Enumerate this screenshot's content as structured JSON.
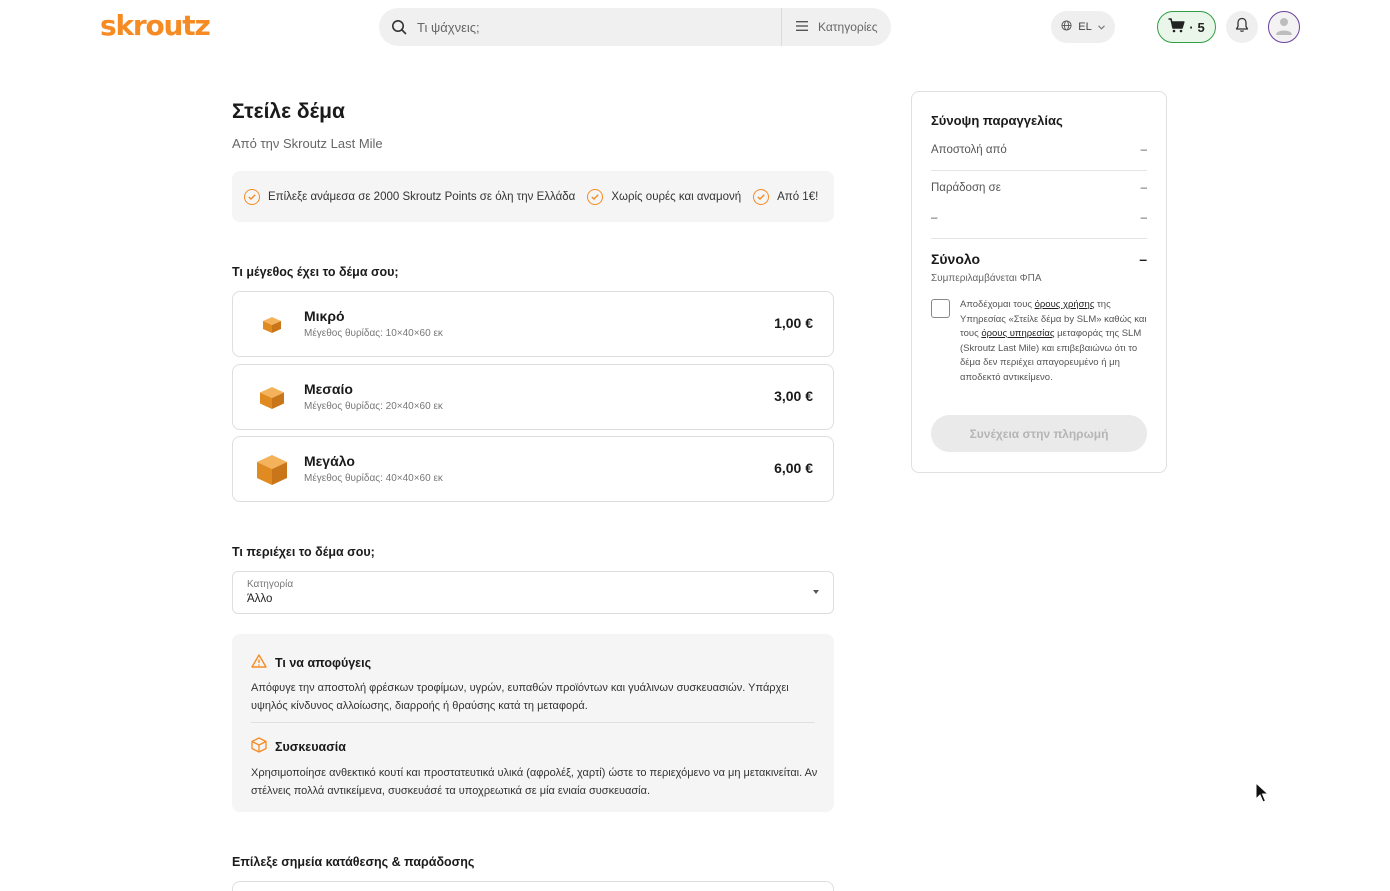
{
  "header": {
    "logo": "skroutz",
    "search_placeholder": "Τι ψάχνεις;",
    "categories_label": "Κατηγορίες",
    "language": "EL",
    "cart_count": "5"
  },
  "page": {
    "title": "Στείλε δέμα",
    "subtitle": "Από την Skroutz Last Mile"
  },
  "benefits": [
    "Επίλεξε ανάμεσα σε 2000 Skroutz Points σε όλη την Ελλάδα",
    "Χωρίς ουρές και αναμονή",
    "Από 1€!"
  ],
  "size_section": {
    "title": "Τι μέγεθος έχει το δέμα σου;",
    "options": [
      {
        "name": "Μικρό",
        "dims": "Μέγεθος θυρίδας: 10×40×60 εκ",
        "price": "1,00 €"
      },
      {
        "name": "Μεσαίο",
        "dims": "Μέγεθος θυρίδας: 20×40×60 εκ",
        "price": "3,00 €"
      },
      {
        "name": "Μεγάλο",
        "dims": "Μέγεθος θυρίδας: 40×40×60 εκ",
        "price": "6,00 €"
      }
    ]
  },
  "contents_section": {
    "title": "Τι περιέχει το δέμα σου;",
    "category_label": "Κατηγορία",
    "category_value": "Άλλο"
  },
  "info": {
    "avoid_title": "Τι να αποφύγεις",
    "avoid_text": "Απόφυγε την αποστολή φρέσκων τροφίμων, υγρών, ευπαθών προϊόντων και γυάλινων συσκευασιών. Υπάρχει υψηλός κίνδυνος αλλοίωσης, διαρροής ή θραύσης κατά τη μεταφορά.",
    "packaging_title": "Συσκευασία",
    "packaging_text": "Χρησιμοποίησε ανθεκτικό κουτί και προστατευτικά υλικά (αφρολέξ, χαρτί) ώστε το περιεχόμενο να μη μετακινείται. Αν στέλνεις πολλά αντικείμενα, συσκευάσέ τα υποχρεωτικά σε μία ενιαία συσκευασία."
  },
  "points_section": {
    "title": "Επίλεξε σημεία κατάθεσης & παράδοσης"
  },
  "summary": {
    "title": "Σύνοψη παραγγελίας",
    "ship_from_label": "Αποστολή από",
    "ship_from_value": "–",
    "deliver_to_label": "Παράδοση σε",
    "deliver_to_value": "–",
    "extra_label": "–",
    "extra_value": "–",
    "total_label": "Σύνολο",
    "total_value": "–",
    "vat_note": "Συμπεριλαμβάνεται ΦΠΑ",
    "terms_1": "Αποδέχομαι τους ",
    "terms_link_1": "όρους χρήσης",
    "terms_2": " της Υπηρεσίας «Στείλε δέμα by SLM» καθώς και τους ",
    "terms_link_2": "όρους υπηρεσίας",
    "terms_3": " μεταφοράς της SLM (Skroutz Last Mile) και επιβεβαιώνω ότι το δέμα δεν περιέχει απαγορευμένο ή μη αποδεκτό αντικείμενο.",
    "pay_button": "Συνέχεια στην πληρωμή"
  },
  "colors": {
    "brand": "#f68b24",
    "cart_border": "#2f9e44",
    "avatar_ring": "#6b3fa0"
  }
}
